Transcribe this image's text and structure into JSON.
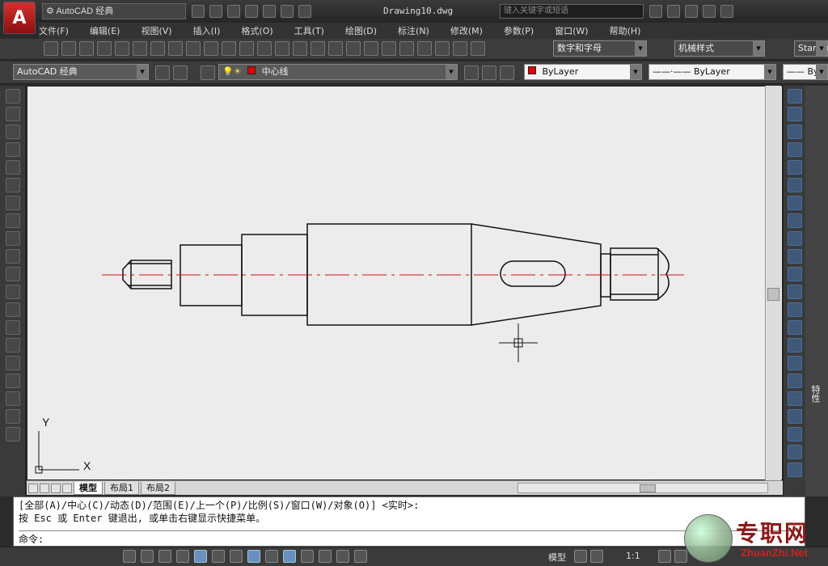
{
  "app": {
    "logo": "A",
    "workspace": "AutoCAD 经典",
    "document": "Drawing10.dwg"
  },
  "search": {
    "placeholder": "键入关键字或短语"
  },
  "menu": [
    "文件(F)",
    "编辑(E)",
    "视图(V)",
    "插入(I)",
    "格式(O)",
    "工具(T)",
    "绘图(D)",
    "标注(N)",
    "修改(M)",
    "参数(P)",
    "窗口(W)",
    "帮助(H)"
  ],
  "styles": {
    "text_style": "数字和字母",
    "dim_style": "机械样式",
    "table_style": "Standa"
  },
  "layers": {
    "workspace": "AutoCAD 经典",
    "current_layer": "中心线",
    "color": "ByLayer",
    "linetype": "ByLayer",
    "lineweight": "By"
  },
  "layout_tabs": [
    "模型",
    "布局1",
    "布局2"
  ],
  "palette_tab": "特性",
  "axes": {
    "y": "Y",
    "x": "X"
  },
  "command": {
    "line1": "[全部(A)/中心(C)/动态(D)/范围(E)/上一个(P)/比例(S)/窗口(W)/对象(O)] <实时>:",
    "line2": "按 Esc 或 Enter 键退出, 或单击右键显示快捷菜单。",
    "prompt": "命令:"
  },
  "status": {
    "model": "模型",
    "scale": "1:1"
  },
  "watermark": {
    "cn": "专职网",
    "url": "ZhuanZhi.Net"
  },
  "colors": {
    "red": "#d01010",
    "layer_red": "#e00000",
    "canvas": "#ececec"
  },
  "icons": {
    "qa_toolbar": [
      "new-icon",
      "open-icon",
      "save-icon",
      "saveas-icon",
      "undo-icon",
      "redo-icon",
      "print-icon"
    ],
    "std_toolbar": [
      "qnew-icon",
      "open-icon",
      "save-icon",
      "plot-icon",
      "preview-icon",
      "publish-icon",
      "3d-icon",
      "cut-icon",
      "copy-icon",
      "paste-icon",
      "matchprop-icon",
      "blockeditor-icon",
      "undo-icon",
      "redo-icon",
      "pan-icon",
      "zoom-realtime-icon",
      "zoom-window-icon",
      "zoom-previous-icon",
      "properties-icon",
      "designcenter-icon",
      "toolpalettes-icon",
      "sheetset-icon",
      "markup-icon",
      "calculator-icon",
      "help-icon"
    ],
    "draw": [
      "line-icon",
      "construction-line-icon",
      "polyline-icon",
      "polygon-icon",
      "rectangle-icon",
      "arc-icon",
      "circle-icon",
      "revision-cloud-icon",
      "spline-icon",
      "ellipse-icon",
      "ellipse-arc-icon",
      "insert-block-icon",
      "make-block-icon",
      "point-icon",
      "hatch-icon",
      "gradient-icon",
      "region-icon",
      "table-icon",
      "mtext-icon",
      "add-selected-icon"
    ],
    "modify": [
      "erase-icon",
      "copy-icon",
      "mirror-icon",
      "offset-icon",
      "array-icon",
      "move-icon",
      "rotate-icon",
      "scale-icon",
      "stretch-icon",
      "trim-icon",
      "extend-icon",
      "break-at-point-icon",
      "break-icon",
      "join-icon",
      "chamfer-icon",
      "fillet-icon",
      "explode-icon",
      "draworder-icon",
      "bring-front-icon",
      "send-back-icon",
      "bring-above-icon",
      "send-under-icon"
    ],
    "status": [
      "infer-icon",
      "snap-icon",
      "grid-icon",
      "ortho-icon",
      "polar-icon",
      "osnap-icon",
      "3dosnap-icon",
      "otrack-icon",
      "ducs-icon",
      "dyn-icon",
      "lineweight-icon",
      "transparency-icon",
      "qp-icon",
      "sc-icon"
    ]
  }
}
